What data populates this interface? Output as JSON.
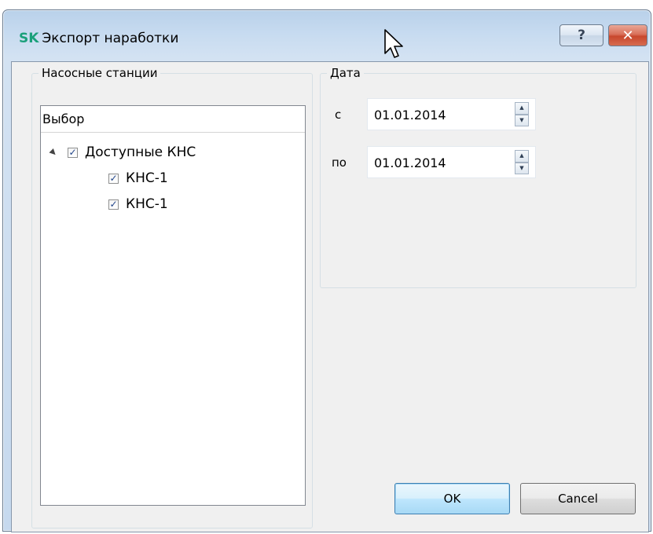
{
  "window": {
    "logo": "SK",
    "title": "Экспорт наработки",
    "help_label": "?",
    "close_label": "✕"
  },
  "stations": {
    "group_label": "Насосные станции",
    "tree_header": "Выбор",
    "root": {
      "label": "Доступные КНС",
      "checked": true,
      "expanded": true
    },
    "children": [
      {
        "label": "КНС-1",
        "checked": true
      },
      {
        "label": "КНС-1",
        "checked": true
      }
    ]
  },
  "date": {
    "group_label": "Дата",
    "from_label": "с",
    "from_value": "01.01.2014",
    "to_label": "по",
    "to_value": "01.01.2014"
  },
  "buttons": {
    "ok": "OK",
    "cancel": "Cancel"
  },
  "colors": {
    "logo": "#1aa07a",
    "close_button": "#c8472d",
    "ok_border": "#3c7fb1"
  },
  "icons": {
    "help": "help-icon",
    "close": "close-icon",
    "expander": "expander-triangle-icon",
    "checkbox": "checkmark-icon",
    "spin_up": "spin-up-arrow-icon",
    "spin_down": "spin-down-arrow-icon",
    "cursor": "mouse-pointer-icon"
  }
}
